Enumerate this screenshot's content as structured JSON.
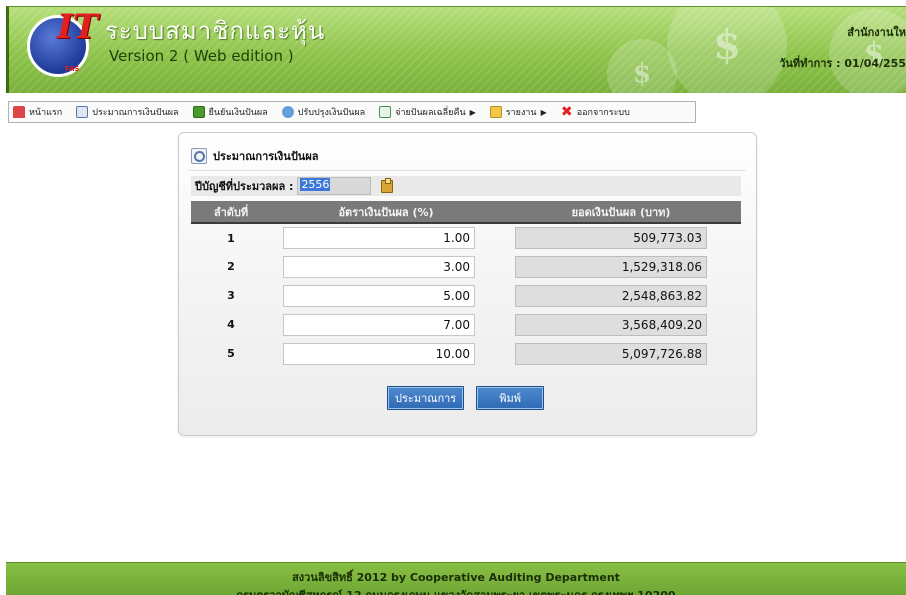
{
  "header": {
    "app_title": "ระบบสมาชิกและหุ้น",
    "app_version": "Version 2 ( Web edition )",
    "org_name": "สำนักงานให",
    "work_date": "วันที่ทำการ : 01/04/255",
    "logo_text": "IT",
    "logo_sub": "FAS",
    "coin_symbol": "$"
  },
  "menu": {
    "items": [
      {
        "label": "หน้าแรก",
        "icon": "home-icon"
      },
      {
        "label": "ประมาณการเงินปันผล",
        "icon": "calculator-icon"
      },
      {
        "label": "ยืนยันเงินปันผล",
        "icon": "confirm-icon"
      },
      {
        "label": "ปรับปรุงเงินปันผล",
        "icon": "adjust-icon"
      },
      {
        "label": "จ่ายปันผลเฉลี่ยคืน",
        "icon": "pay-icon",
        "has_submenu": true
      },
      {
        "label": "รายงาน",
        "icon": "report-folder-icon",
        "has_submenu": true
      },
      {
        "label": "ออกจากระบบ",
        "icon": "logout-x-icon"
      }
    ]
  },
  "panel": {
    "title": "ประมาณการเงินปันผล",
    "year_label": "ปีบัญชีที่ประมวลผล :",
    "year_value": "2556",
    "table": {
      "headers": [
        "ลำดับที่",
        "อัตราเงินปันผล (%)",
        "ยอดเงินปันผล (บาท)"
      ],
      "rows": [
        {
          "index": "1",
          "rate": "1.00",
          "amount": "509,773.03"
        },
        {
          "index": "2",
          "rate": "3.00",
          "amount": "1,529,318.06"
        },
        {
          "index": "3",
          "rate": "5.00",
          "amount": "2,548,863.82"
        },
        {
          "index": "4",
          "rate": "7.00",
          "amount": "3,568,409.20"
        },
        {
          "index": "5",
          "rate": "10.00",
          "amount": "5,097,726.88"
        }
      ]
    },
    "buttons": {
      "estimate": "ประมาณการ",
      "print": "พิมพ์"
    }
  },
  "footer": {
    "line1": "สงวนลิขสิทธิ์ 2012 by Cooperative Auditing Department",
    "line2": "กรมตรวจบัญชีสหกรณ์ 12 ถนนกรุงเกษม แขวงวัดสามพระยา เขตพระนคร กรุงเทพฯ 10200"
  },
  "colors": {
    "header_green": "#8dc34a",
    "button_blue": "#2f6ab5",
    "table_header_gray": "#7a7a7a"
  }
}
